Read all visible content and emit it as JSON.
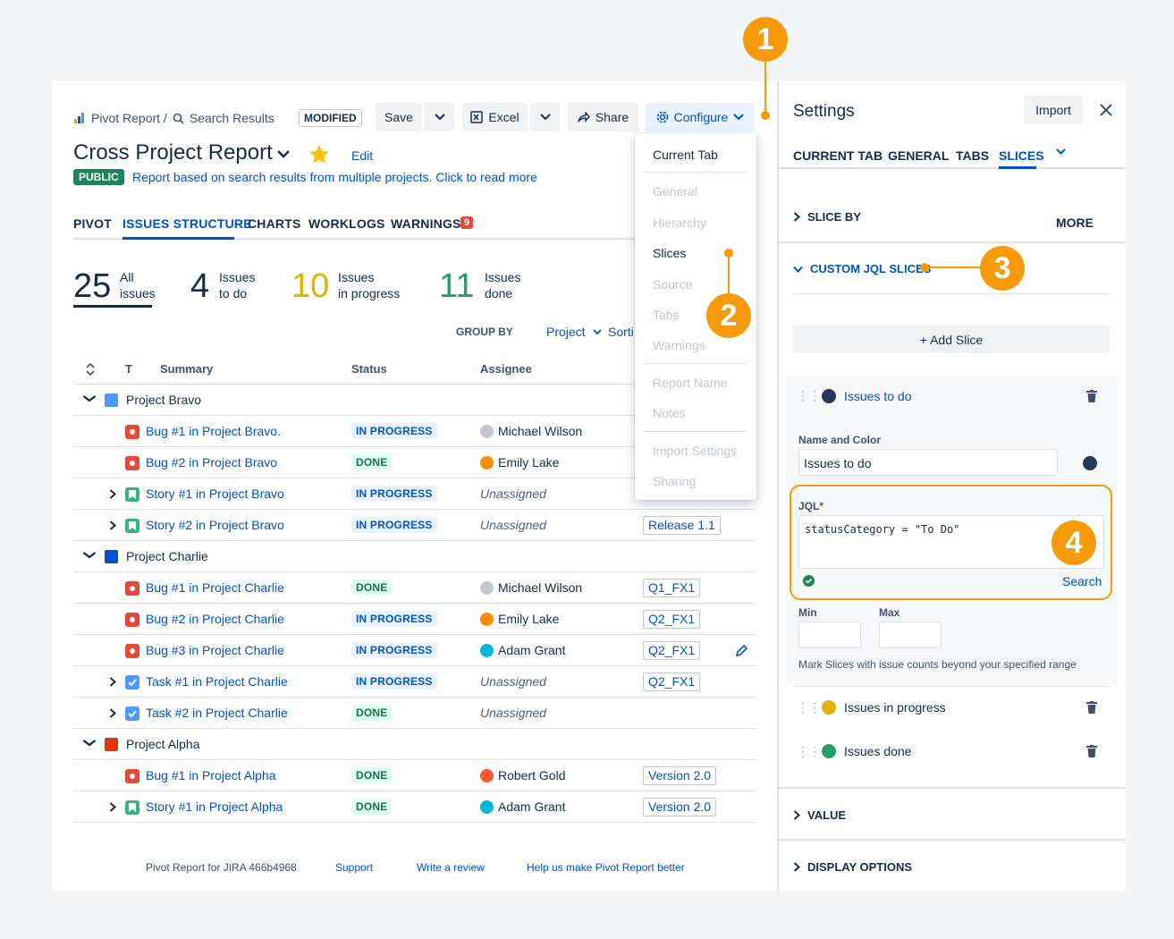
{
  "breadcrumb": {
    "app": "Pivot Report /",
    "page": "Search Results"
  },
  "badge_modified": "MODIFIED",
  "toolbar": {
    "save": "Save",
    "excel": "Excel",
    "share": "Share",
    "configure": "Configure"
  },
  "report": {
    "title": "Cross Project Report",
    "edit": "Edit",
    "public_badge": "PUBLIC",
    "description": "Report based on search results from multiple projects. Click to read more"
  },
  "tabs": [
    {
      "label": "PIVOT"
    },
    {
      "label": "ISSUES STRUCTURE"
    },
    {
      "label": "CHARTS"
    },
    {
      "label": "WORKLOGS"
    },
    {
      "label": "WARNINGS"
    }
  ],
  "warnings_count": "9",
  "stats": [
    {
      "n": "25",
      "l1": "All",
      "l2": "issues",
      "color": "#172b4d"
    },
    {
      "n": "4",
      "l1": "Issues",
      "l2": "to do",
      "color": "#172b4d"
    },
    {
      "n": "10",
      "l1": "Issues",
      "l2": "in progress",
      "color": "#e2b203"
    },
    {
      "n": "11",
      "l1": "Issues",
      "l2": "done",
      "color": "#22a06b"
    }
  ],
  "group_by": {
    "label": "GROUP BY",
    "value": "Project",
    "sort": "Sorti"
  },
  "columns": {
    "t": "T",
    "summary": "Summary",
    "status": "Status",
    "assignee": "Assignee"
  },
  "rows": [
    {
      "kind": "group",
      "name": "Project Bravo",
      "icon": "#4c9aff"
    },
    {
      "kind": "issue",
      "type": "bug",
      "summary": "Bug #1 in Project Bravo.",
      "status": "IN PROGRESS",
      "st": "prog",
      "assignee": "Michael Wilson",
      "av": "#c1c7d0",
      "ver": ""
    },
    {
      "kind": "issue",
      "type": "bug",
      "summary": "Bug #2 in Project Bravo",
      "status": "DONE",
      "st": "done",
      "assignee": "Emily Lake",
      "av": "#ff8b00",
      "ver": ""
    },
    {
      "kind": "issue",
      "type": "story",
      "summary": "Story #1 in Project Bravo",
      "status": "IN PROGRESS",
      "st": "prog",
      "assignee": "Unassigned",
      "av": "",
      "ver": "",
      "exp": true
    },
    {
      "kind": "issue",
      "type": "story",
      "summary": "Story #2 in Project Bravo",
      "status": "IN PROGRESS",
      "st": "prog",
      "assignee": "Unassigned",
      "av": "",
      "ver": "Release 1.1",
      "exp": true
    },
    {
      "kind": "group",
      "name": "Project Charlie",
      "icon": "#0052cc"
    },
    {
      "kind": "issue",
      "type": "bug",
      "summary": "Bug #1 in Project Charlie",
      "status": "DONE",
      "st": "done",
      "assignee": "Michael Wilson",
      "av": "#c1c7d0",
      "ver": "Q1_FX1"
    },
    {
      "kind": "issue",
      "type": "bug",
      "summary": "Bug #2 in Project Charlie",
      "status": "IN PROGRESS",
      "st": "prog",
      "assignee": "Emily Lake",
      "av": "#ff8b00",
      "ver": "Q2_FX1"
    },
    {
      "kind": "issue",
      "type": "bug",
      "summary": "Bug #3 in Project Charlie",
      "status": "IN PROGRESS",
      "st": "prog",
      "assignee": "Adam Grant",
      "av": "#00b8d9",
      "ver": "Q2_FX1",
      "edit": true
    },
    {
      "kind": "issue",
      "type": "task",
      "summary": "Task #1 in Project Charlie",
      "status": "IN PROGRESS",
      "st": "prog",
      "assignee": "Unassigned",
      "av": "",
      "ver": "Q2_FX1",
      "exp": true
    },
    {
      "kind": "issue",
      "type": "task",
      "summary": "Task #2 in Project Charlie",
      "status": "DONE",
      "st": "done",
      "assignee": "Unassigned",
      "av": "",
      "ver": "",
      "exp": true
    },
    {
      "kind": "group",
      "name": "Project Alpha",
      "icon": "#de350b"
    },
    {
      "kind": "issue",
      "type": "bug",
      "summary": "Bug #1 in Project Alpha",
      "status": "DONE",
      "st": "done",
      "assignee": "Robert Gold",
      "av": "#ff5630",
      "ver": "Version 2.0"
    },
    {
      "kind": "issue",
      "type": "story",
      "summary": "Story #1 in Project Alpha",
      "status": "DONE",
      "st": "done",
      "assignee": "Adam Grant",
      "av": "#00b8d9",
      "ver": "Version 2.0",
      "exp": true
    }
  ],
  "menu": {
    "items": [
      "Current Tab",
      "General",
      "Hierarchy",
      "Slices",
      "Source",
      "Tabs",
      "Warnings",
      "Report Name",
      "Notes",
      "Import Settings",
      "Sharing"
    ]
  },
  "footer": {
    "version": "Pivot Report for JIRA 466b4968",
    "support": "Support",
    "review": "Write a review",
    "help": "Help us make Pivot Report better"
  },
  "settings": {
    "title": "Settings",
    "import": "Import",
    "tabs": [
      "CURRENT TAB",
      "GENERAL",
      "TABS",
      "SLICES",
      "MORE"
    ],
    "slice_by": "SLICE BY",
    "custom": "CUSTOM JQL SLICES",
    "add_slice": "+ Add Slice",
    "slice1": {
      "name": "Issues to do",
      "color": "#253858"
    },
    "name_color_label": "Name and Color",
    "name_value": "Issues to do",
    "jql_label": "JQL",
    "jql": "statusCategory = \"To Do\"",
    "search": "Search",
    "min": "Min",
    "max": "Max",
    "range_hint": "Mark Slices with issue counts beyond your specified range",
    "slice2": {
      "name": "Issues in progress",
      "color": "#e2b203"
    },
    "slice3": {
      "name": "Issues done",
      "color": "#22a06b"
    },
    "value": "VALUE",
    "display": "DISPLAY OPTIONS"
  },
  "callouts": [
    "1",
    "2",
    "3",
    "4"
  ]
}
